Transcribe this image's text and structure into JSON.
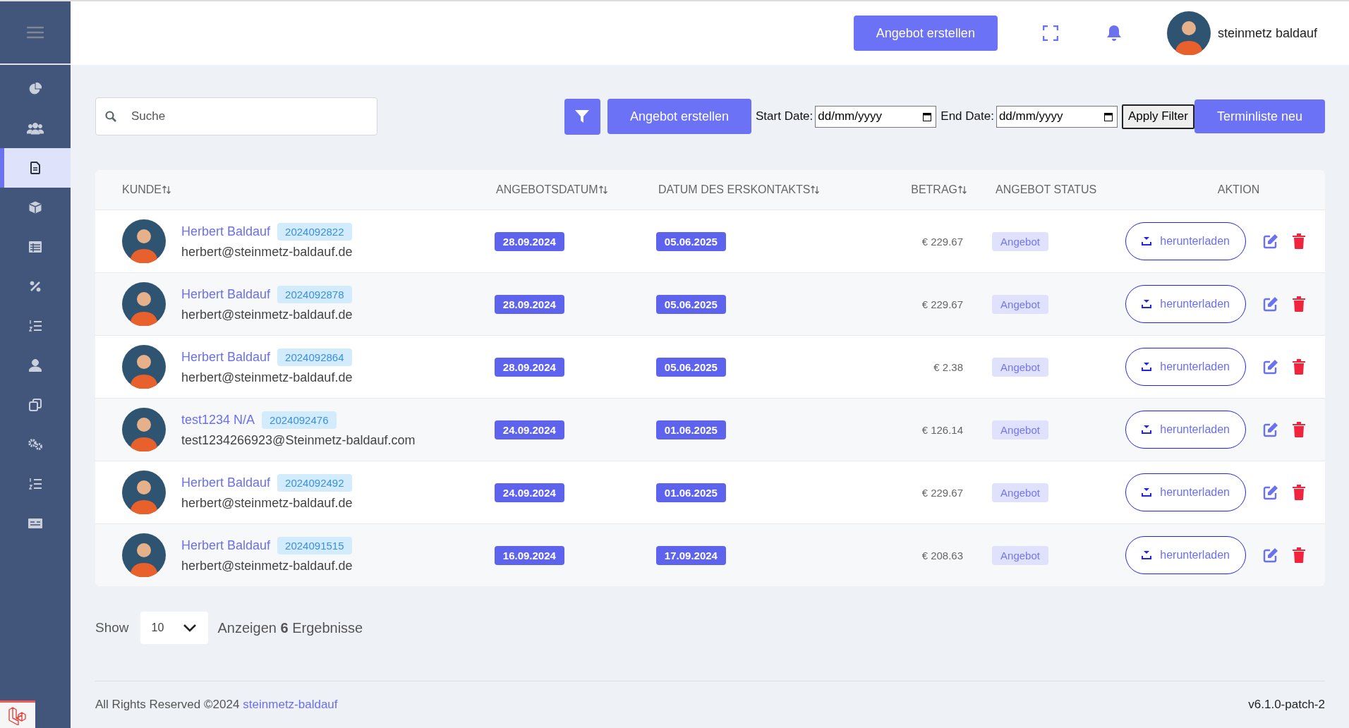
{
  "topbar": {
    "create_button": "Angebot erstellen",
    "user_name": "steinmetz baldauf"
  },
  "sidebar": {
    "items": [
      {
        "kind": "chart",
        "selected": false
      },
      {
        "kind": "users",
        "selected": false
      },
      {
        "kind": "document",
        "selected": true
      },
      {
        "kind": "box",
        "selected": false
      },
      {
        "kind": "table",
        "selected": false
      },
      {
        "kind": "percent",
        "selected": false
      },
      {
        "kind": "list",
        "selected": false
      },
      {
        "kind": "user",
        "selected": false
      },
      {
        "kind": "copy",
        "selected": false
      },
      {
        "kind": "gears",
        "selected": false
      },
      {
        "kind": "list",
        "selected": false
      },
      {
        "kind": "card",
        "selected": false
      }
    ]
  },
  "filters": {
    "search": {
      "placeholder": "Suche"
    },
    "create_button": "Angebot erstellen",
    "start_label": "Start Date:",
    "start_value": "dd/mm/yyyy",
    "end_label": "End Date:",
    "end_value": "dd/mm/yyyy",
    "apply_button": "Apply Filter",
    "new_list_button": "Terminliste neu"
  },
  "table": {
    "columns": [
      {
        "label": "KUNDE",
        "sortable": true
      },
      {
        "label": "ANGEBOTSDATUM",
        "sortable": true
      },
      {
        "label": "DATUM DES ERSKONTAKTS",
        "sortable": true
      },
      {
        "label": "BETRAG",
        "sortable": true
      },
      {
        "label": "ANGEBOT STATUS",
        "sortable": false
      },
      {
        "label": "AKTION",
        "sortable": false
      }
    ],
    "rows": [
      {
        "name": "Herbert Baldauf",
        "number": "2024092822",
        "email": "herbert@steinmetz-baldauf.de",
        "offer_date": "28.09.2024",
        "contact_date": "05.06.2025",
        "amount": "€ 229.67",
        "status": "Angebot",
        "action": "herunterladen"
      },
      {
        "name": "Herbert Baldauf",
        "number": "2024092878",
        "email": "herbert@steinmetz-baldauf.de",
        "offer_date": "28.09.2024",
        "contact_date": "05.06.2025",
        "amount": "€ 229.67",
        "status": "Angebot",
        "action": "herunterladen"
      },
      {
        "name": "Herbert Baldauf",
        "number": "2024092864",
        "email": "herbert@steinmetz-baldauf.de",
        "offer_date": "28.09.2024",
        "contact_date": "05.06.2025",
        "amount": "€ 2.38",
        "status": "Angebot",
        "action": "herunterladen"
      },
      {
        "name": "test1234 N/A",
        "number": "2024092476",
        "email": "test1234266923@Steinmetz-baldauf.com",
        "offer_date": "24.09.2024",
        "contact_date": "01.06.2025",
        "amount": "€ 126.14",
        "status": "Angebot",
        "action": "herunterladen"
      },
      {
        "name": "Herbert Baldauf",
        "number": "2024092492",
        "email": "herbert@steinmetz-baldauf.de",
        "offer_date": "24.09.2024",
        "contact_date": "01.06.2025",
        "amount": "€ 229.67",
        "status": "Angebot",
        "action": "herunterladen"
      },
      {
        "name": "Herbert Baldauf",
        "number": "2024091515",
        "email": "herbert@steinmetz-baldauf.de",
        "offer_date": "16.09.2024",
        "contact_date": "17.09.2024",
        "amount": "€ 208.63",
        "status": "Angebot",
        "action": "herunterladen"
      }
    ]
  },
  "pagination": {
    "show_label": "Show",
    "page_size": "10",
    "summary": "Anzeigen **6** Ergebnisse"
  },
  "footer": {
    "copyright": "All Rights Reserved ©2024",
    "link": "steinmetz-baldauf",
    "version": "v6.1.0-patch-2"
  }
}
